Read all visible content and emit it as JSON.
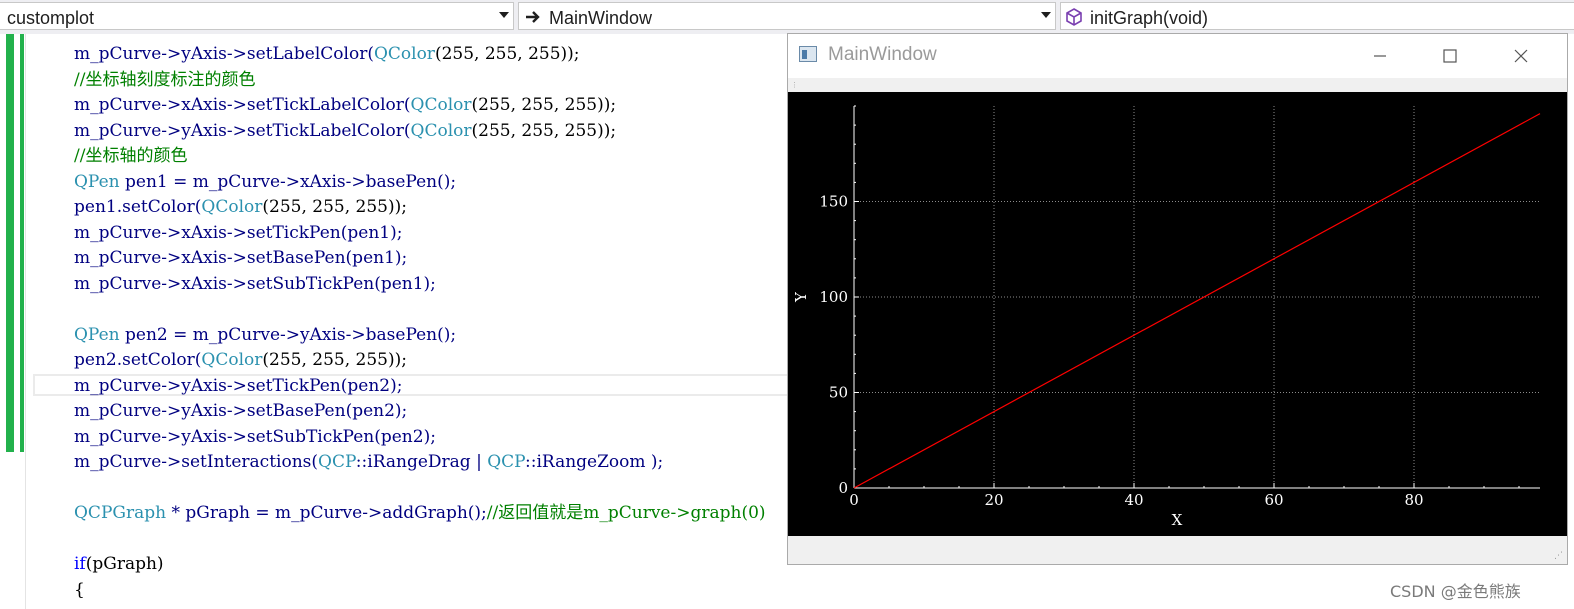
{
  "nav": {
    "project": "customplot",
    "class_scope": "MainWindow",
    "member": "initGraph(void)"
  },
  "code": [
    [
      {
        "t": "m_pCurve->yAxis->setLabelColor(",
        "c": "t-obj"
      },
      {
        "t": "QColor",
        "c": "t-cls"
      },
      {
        "t": "(255, 255, 255));",
        "c": "t-plain"
      }
    ],
    [
      {
        "t": "//坐标轴刻度标注的颜色",
        "c": "t-cm"
      }
    ],
    [
      {
        "t": "m_pCurve->xAxis->setTickLabelColor(",
        "c": "t-obj"
      },
      {
        "t": "QColor",
        "c": "t-cls"
      },
      {
        "t": "(255, 255, 255));",
        "c": "t-plain"
      }
    ],
    [
      {
        "t": "m_pCurve->yAxis->setTickLabelColor(",
        "c": "t-obj"
      },
      {
        "t": "QColor",
        "c": "t-cls"
      },
      {
        "t": "(255, 255, 255));",
        "c": "t-plain"
      }
    ],
    [
      {
        "t": "//坐标轴的颜色",
        "c": "t-cm"
      }
    ],
    [
      {
        "t": "QPen",
        "c": "t-cls"
      },
      {
        "t": " pen1 = m_pCurve->xAxis->basePen();",
        "c": "t-obj"
      }
    ],
    [
      {
        "t": "pen1.setColor(",
        "c": "t-obj"
      },
      {
        "t": "QColor",
        "c": "t-cls"
      },
      {
        "t": "(255, 255, 255));",
        "c": "t-plain"
      }
    ],
    [
      {
        "t": "m_pCurve->xAxis->setTickPen(pen1);",
        "c": "t-obj"
      }
    ],
    [
      {
        "t": "m_pCurve->xAxis->setBasePen(pen1);",
        "c": "t-obj"
      }
    ],
    [
      {
        "t": "m_pCurve->xAxis->setSubTickPen(pen1);",
        "c": "t-obj"
      }
    ],
    [],
    [
      {
        "t": "QPen",
        "c": "t-cls"
      },
      {
        "t": " pen2 = m_pCurve->yAxis->basePen();",
        "c": "t-obj"
      }
    ],
    [
      {
        "t": "pen2.setColor(",
        "c": "t-obj"
      },
      {
        "t": "QColor",
        "c": "t-cls"
      },
      {
        "t": "(255, 255, 255));",
        "c": "t-plain"
      }
    ],
    [
      {
        "t": "m_pCurve->yAxis->setTickPen(pen2);",
        "c": "t-obj"
      }
    ],
    [
      {
        "t": "m_pCurve->yAxis->setBasePen(pen2);",
        "c": "t-obj"
      }
    ],
    [
      {
        "t": "m_pCurve->yAxis->setSubTickPen(pen2);",
        "c": "t-obj"
      }
    ],
    [
      {
        "t": "m_pCurve->setInteractions(",
        "c": "t-obj"
      },
      {
        "t": "QCP",
        "c": "t-cls"
      },
      {
        "t": "::iRangeDrag | ",
        "c": "t-obj"
      },
      {
        "t": "QCP",
        "c": "t-cls"
      },
      {
        "t": "::iRangeZoom );",
        "c": "t-obj"
      }
    ],
    [],
    [
      {
        "t": "QCPGraph",
        "c": "t-cls"
      },
      {
        "t": " * pGraph = m_pCurve->addGraph();",
        "c": "t-obj"
      },
      {
        "t": "//返回值就是m_pCurve->graph(0)",
        "c": "t-cm"
      }
    ],
    [],
    [
      {
        "t": "if",
        "c": "t-kw"
      },
      {
        "t": "(pGraph)",
        "c": "t-plain"
      }
    ],
    [
      {
        "t": "{",
        "c": "t-plain"
      }
    ]
  ],
  "window": {
    "title": "MainWindow",
    "minimize_icon": "minimize-icon",
    "maximize_icon": "maximize-icon",
    "close_icon": "close-icon"
  },
  "watermark": "CSDN @金色熊族",
  "chart_data": {
    "type": "line",
    "xlabel": "X",
    "ylabel": "Y",
    "xlim": [
      0,
      98
    ],
    "ylim": [
      0,
      200
    ],
    "xticks": [
      0,
      20,
      40,
      60,
      80
    ],
    "yticks": [
      0,
      50,
      100,
      150
    ],
    "grid": true,
    "background": "#000000",
    "axis_color": "#ffffff",
    "series": [
      {
        "color": "#ff0000",
        "x": [
          0,
          98
        ],
        "y": [
          0,
          196
        ]
      }
    ]
  }
}
